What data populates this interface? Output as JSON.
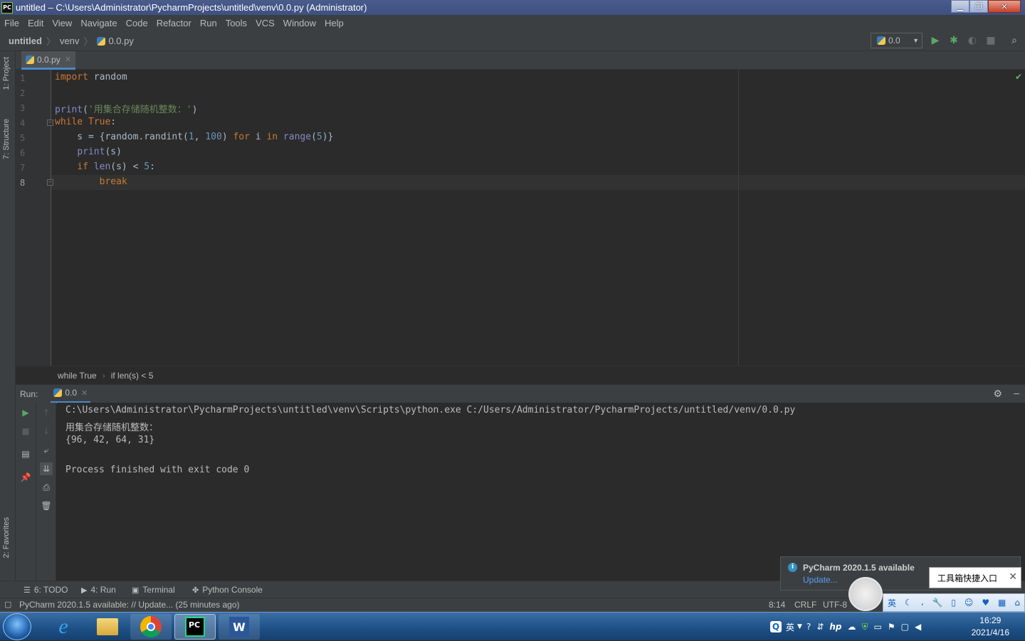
{
  "window": {
    "app_icon": "PC",
    "title": "untitled – C:\\Users\\Administrator\\PycharmProjects\\untitled\\venv\\0.0.py (Administrator)",
    "controls": [
      "minimize-icon",
      "maximize-icon",
      "close-icon"
    ]
  },
  "menu": [
    "File",
    "Edit",
    "View",
    "Navigate",
    "Code",
    "Refactor",
    "Run",
    "Tools",
    "VCS",
    "Window",
    "Help"
  ],
  "nav": {
    "project": "untitled",
    "folder": "venv",
    "file": "0.0.py"
  },
  "run_config": {
    "name": "0.0"
  },
  "left_strip": {
    "project": "1: Project",
    "structure": "7: Structure",
    "favorites": "2: Favorites"
  },
  "editor": {
    "tab": "0.0.py",
    "line_numbers": [
      "1",
      "2",
      "3",
      "4",
      "5",
      "6",
      "7",
      "8"
    ],
    "breadcrumb": [
      "while True",
      "if len(s) < 5"
    ],
    "cursor_line": 8
  },
  "code_lines": {
    "l1": {
      "kw": "import",
      "rest": " random"
    },
    "l3": {
      "fn": "print",
      "open": "(",
      "str": "'用集合存储随机整数：'",
      "close": ")"
    },
    "l4": {
      "kw1": "while",
      "kw2": " True",
      "colon": ":"
    },
    "l5": {
      "a": "    s = {random.randint(",
      "n1": "1",
      "b": ", ",
      "n2": "100",
      "c": ") ",
      "k1": "for",
      "d": " i ",
      "k2": "in",
      "e": " ",
      "f": "range",
      "g": "(",
      "n3": "5",
      "h": ")}"
    },
    "l6": {
      "a": "    ",
      "fn": "print",
      "b": "(s)"
    },
    "l7": {
      "a": "    ",
      "kw": "if",
      "b": " ",
      "fn": "len",
      "c": "(s) < ",
      "n": "5",
      "d": ":"
    },
    "l8": {
      "a": "        ",
      "kw": "break"
    }
  },
  "run_panel": {
    "label": "Run:",
    "tab": "0.0",
    "output": [
      "C:\\Users\\Administrator\\PycharmProjects\\untitled\\venv\\Scripts\\python.exe C:/Users/Administrator/PycharmProjects/untitled/venv/0.0.py",
      "用集合存储随机整数：",
      "{96, 42, 64, 31}",
      "",
      "Process finished with exit code 0"
    ]
  },
  "tool_tabs": {
    "todo": "6: TODO",
    "run": "4: Run",
    "terminal": "Terminal",
    "python_console": "Python Console"
  },
  "status": {
    "message": "PyCharm 2020.1.5 available: // Update... (25 minutes ago)",
    "position": "8:14",
    "line_sep": "CRLF",
    "encoding": "UTF-8"
  },
  "notification": {
    "title": "PyCharm 2020.1.5 available",
    "link": "Update..."
  },
  "ime_tooltip": "工具箱快捷入口",
  "ime_bar_lang": "英",
  "tray": {
    "lang": "英",
    "time": "16:29",
    "date": "2021/4/16"
  },
  "colors": {
    "keyword": "#cc7832",
    "builtin": "#8888c6",
    "string": "#6a8759",
    "number": "#6897bb",
    "accent": "#4a88c7"
  }
}
